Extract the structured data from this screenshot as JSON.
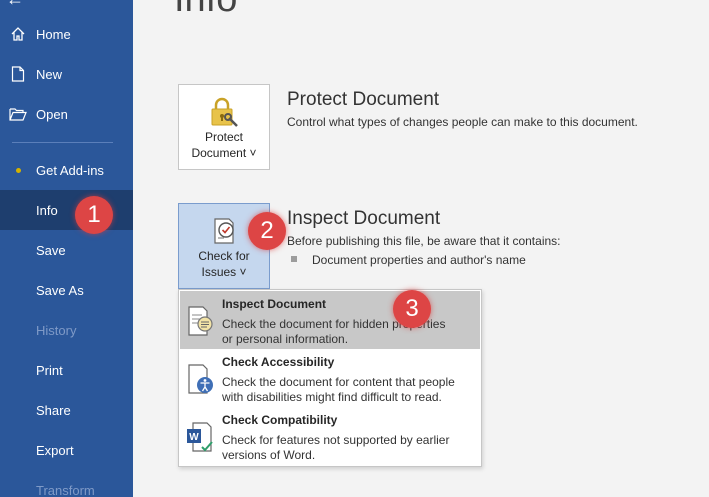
{
  "page": {
    "title": "Info"
  },
  "sidebar": {
    "items": [
      {
        "label": "Home"
      },
      {
        "label": "New"
      },
      {
        "label": "Open"
      },
      {
        "label": "Get Add-ins"
      },
      {
        "label": "Info"
      },
      {
        "label": "Save"
      },
      {
        "label": "Save As"
      },
      {
        "label": "History"
      },
      {
        "label": "Print"
      },
      {
        "label": "Share"
      },
      {
        "label": "Export"
      },
      {
        "label": "Transform"
      }
    ]
  },
  "protect": {
    "button_line1": "Protect",
    "button_line2": "Document ˅",
    "title": "Protect Document",
    "desc": "Control what types of changes people can make to this document."
  },
  "inspect": {
    "button_line1": "Check for",
    "button_line2": "Issues ˅",
    "title": "Inspect Document",
    "desc": "Before publishing this file, be aware that it contains:",
    "bullet": "Document properties and author's name"
  },
  "menu": {
    "items": [
      {
        "title": "Inspect Document",
        "line1": "Check the document for hidden properties",
        "line2": "or personal information."
      },
      {
        "title": "Check Accessibility",
        "line1": "Check the document for content that people",
        "line2": "with disabilities might find difficult to read."
      },
      {
        "title": "Check Compatibility",
        "line1": "Check for features not supported by earlier",
        "line2": "versions of Word."
      }
    ]
  },
  "badges": [
    "1",
    "2",
    "3"
  ],
  "colors": {
    "sidebar": "#2b579a",
    "sidebar_active": "#1e3e6e",
    "badge": "#dd4545",
    "selected": "#c5d7ee"
  }
}
